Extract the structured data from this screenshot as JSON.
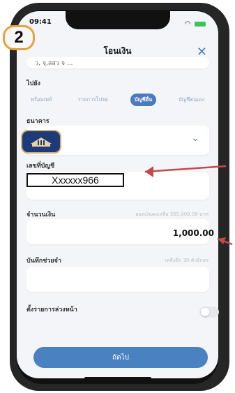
{
  "status": {
    "time": "09:41"
  },
  "step_badge": "2",
  "header": {
    "title": "โอนเงิน"
  },
  "icons": {
    "close": "close-icon",
    "chevron": "chevron-down-icon"
  },
  "source_account_partial": "ว, จุ,สสว จ ...",
  "section_to": "ไปยัง",
  "tabs": [
    {
      "label": "พร้อมเพย์"
    },
    {
      "label": "รายการโปรด"
    },
    {
      "label": "บัญชีอื่น",
      "active": true
    },
    {
      "label": "บัญชีตนเอง"
    }
  ],
  "bank_section": {
    "label": "ธนาคาร"
  },
  "account_section": {
    "label": "เลขที่บัญชี",
    "value": "Xxxxxx966"
  },
  "amount_section": {
    "label": "จำนวนเงิน",
    "hint": "ยอดเงินคงเหลือ 355,000.00 บาท",
    "value": "1,000.00"
  },
  "memo_section": {
    "label": "บันทึกช่วยจำ",
    "hint": "เหลืออีก 30 ตัวอักษร"
  },
  "schedule_section": {
    "label": "ตั้งรายการล่วงหน้า"
  },
  "primary_button": "ถัดไป",
  "colors": {
    "accent": "#4a82c1",
    "annotation": "#c44a4a",
    "badge_ring": "#e9a13b"
  }
}
